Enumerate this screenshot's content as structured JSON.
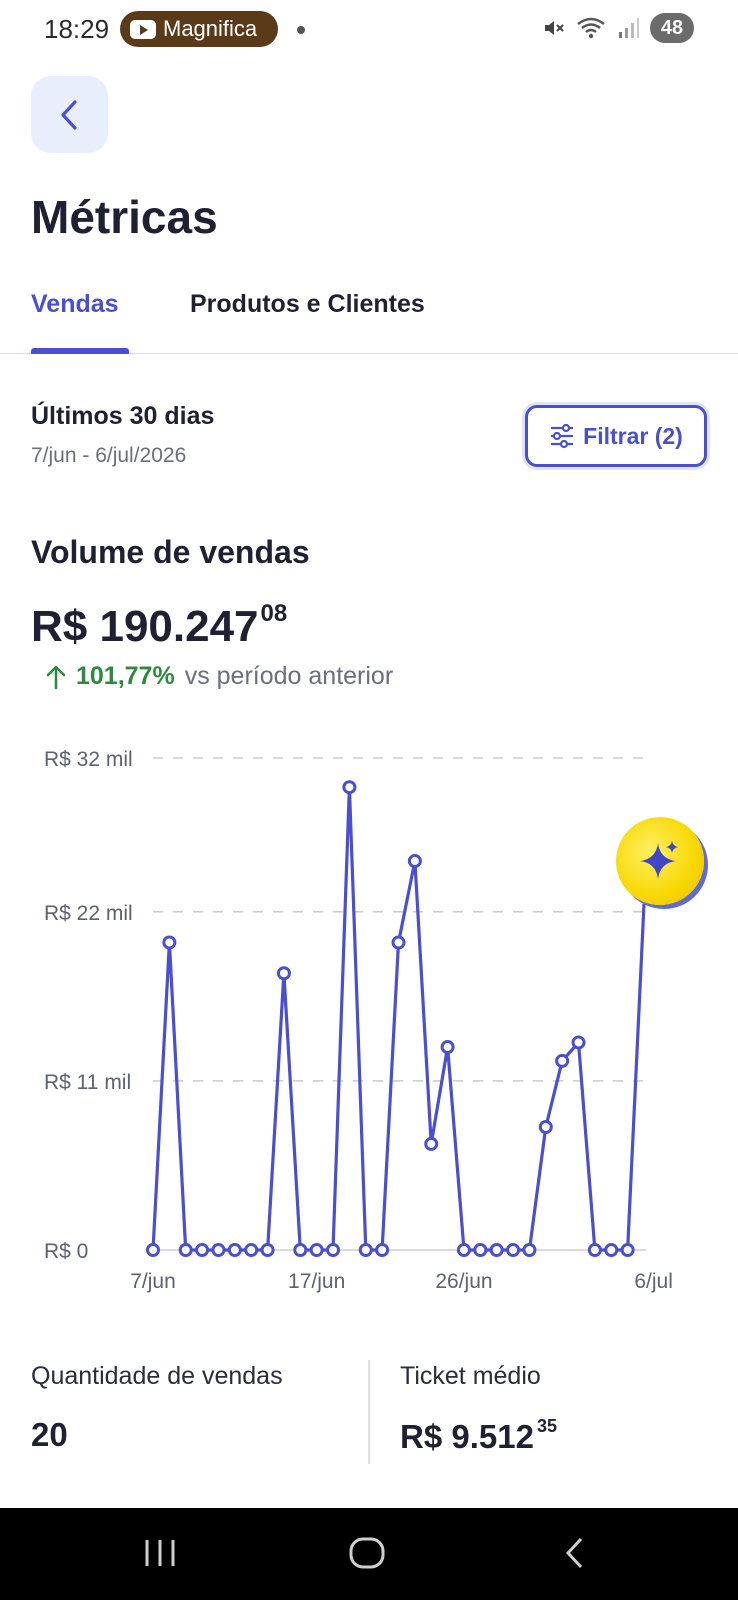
{
  "status_bar": {
    "time": "18:29",
    "notification_app": "Magnifica",
    "battery": "48",
    "icons": [
      "mute-icon",
      "wifi-icon",
      "signal-icon"
    ]
  },
  "header": {
    "title": "Métricas"
  },
  "tabs": [
    {
      "label": "Vendas",
      "active": true
    },
    {
      "label": "Produtos e Clientes",
      "active": false
    }
  ],
  "period": {
    "label": "Últimos 30 dias",
    "dates": "7/jun - 6/jul/2026",
    "filter_label": "Filtrar (2)"
  },
  "volume": {
    "title": "Volume de vendas",
    "value_main": "R$ 190.247",
    "value_cents": "08",
    "change_pct": "101,77%",
    "change_text": "vs período anterior",
    "change_color": "#2e8b3e"
  },
  "chart_data": {
    "type": "line",
    "y_ticks": [
      "R$ 32 mil",
      "R$ 22 mil",
      "R$ 11 mil",
      "R$ 0"
    ],
    "y_tick_values": [
      32000,
      22000,
      11000,
      0
    ],
    "x_ticks": [
      "7/jun",
      "17/jun",
      "26/jun",
      "6/jul"
    ],
    "x_tick_index": [
      0,
      10,
      19,
      29
    ],
    "ylim": [
      0,
      32000
    ],
    "grid": "dashed horizontal",
    "line_color": "#4a4fd0",
    "values": [
      0,
      20000,
      0,
      0,
      0,
      0,
      0,
      0,
      18000,
      0,
      0,
      0,
      30100,
      0,
      0,
      20000,
      25300,
      6900,
      13200,
      0,
      0,
      0,
      0,
      0,
      8000,
      12300,
      13500,
      0,
      0,
      0,
      22500
    ]
  },
  "stats": {
    "quantity_label": "Quantidade de vendas",
    "quantity_value": "20",
    "ticket_label": "Ticket médio",
    "ticket_main": "R$ 9.512",
    "ticket_cents": "35"
  },
  "ai_button": {
    "icon": "sparkle-icon"
  },
  "nav": {
    "icons": [
      "recent-apps-icon",
      "home-icon",
      "back-nav-icon"
    ]
  }
}
